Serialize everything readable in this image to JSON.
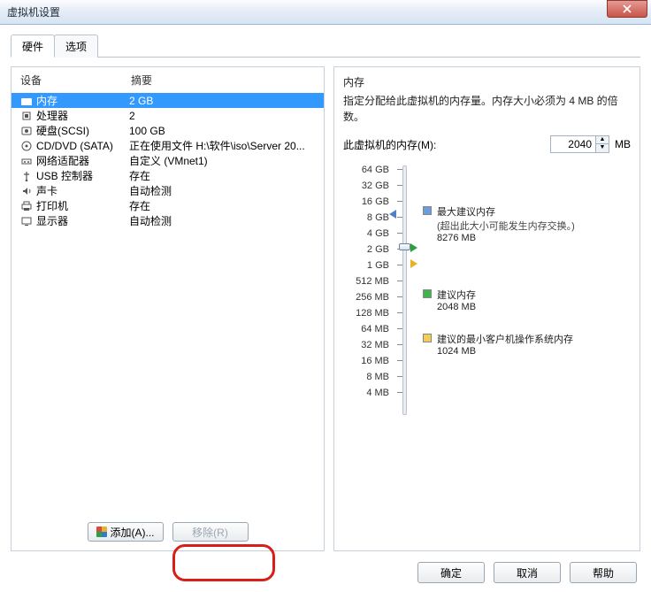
{
  "window": {
    "title": "虚拟机设置"
  },
  "tabs": {
    "hardware": "硬件",
    "options": "选项"
  },
  "columns": {
    "device": "设备",
    "summary": "摘要"
  },
  "devices": [
    {
      "name": "内存",
      "summary": "2 GB",
      "icon": "memory"
    },
    {
      "name": "处理器",
      "summary": "2",
      "icon": "cpu"
    },
    {
      "name": "硬盘(SCSI)",
      "summary": "100 GB",
      "icon": "hdd"
    },
    {
      "name": "CD/DVD (SATA)",
      "summary": "正在使用文件 H:\\软件\\iso\\Server 20...",
      "icon": "cd"
    },
    {
      "name": "网络适配器",
      "summary": "自定义 (VMnet1)",
      "icon": "net"
    },
    {
      "name": "USB 控制器",
      "summary": "存在",
      "icon": "usb"
    },
    {
      "name": "声卡",
      "summary": "自动检测",
      "icon": "sound"
    },
    {
      "name": "打印机",
      "summary": "存在",
      "icon": "printer"
    },
    {
      "name": "显示器",
      "summary": "自动检测",
      "icon": "display"
    }
  ],
  "buttons": {
    "add": "添加(A)...",
    "remove": "移除(R)",
    "ok": "确定",
    "cancel": "取消",
    "help": "帮助"
  },
  "memory": {
    "title": "内存",
    "desc": "指定分配给此虚拟机的内存量。内存大小必须为 4 MB 的倍数。",
    "label": "此虚拟机的内存(M):",
    "value": "2040",
    "unit": "MB",
    "ticks": [
      "64 GB",
      "32 GB",
      "16 GB",
      "8 GB",
      "4 GB",
      "2 GB",
      "1 GB",
      "512 MB",
      "256 MB",
      "128 MB",
      "64 MB",
      "32 MB",
      "16 MB",
      "8 MB",
      "4 MB"
    ],
    "legend": {
      "max": {
        "title": "最大建议内存",
        "note": "(超出此大小可能发生内存交换。)",
        "value": "8276 MB"
      },
      "rec": {
        "title": "建议内存",
        "value": "2048 MB"
      },
      "min": {
        "title": "建议的最小客户机操作系统内存",
        "value": "1024 MB"
      }
    }
  }
}
